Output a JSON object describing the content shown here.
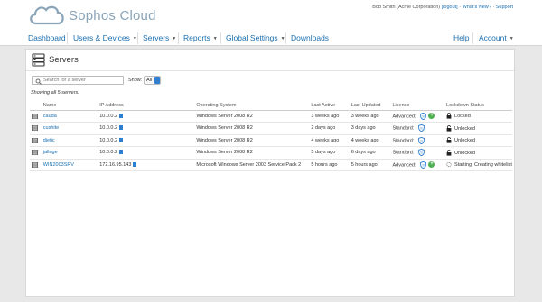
{
  "app": {
    "logo_text": "Sophos Cloud"
  },
  "userbar": {
    "user": "Bob Smith (Acme Corporation)",
    "logout": "[logout]",
    "whats_new": "What's New?",
    "support": "Support",
    "sep": "·"
  },
  "nav": {
    "dashboard": "Dashboard",
    "users_devices": "Users & Devices",
    "servers": "Servers",
    "reports": "Reports",
    "global_settings": "Global Settings",
    "downloads": "Downloads",
    "help": "Help",
    "account": "Account",
    "caret": "▼"
  },
  "page": {
    "title": "Servers",
    "search_placeholder": "Search for a server",
    "show_label": "Show:",
    "show_value": "All",
    "showing_text": "Showing all 5 servers."
  },
  "table": {
    "headers": [
      "Name",
      "IP Address",
      "Operating System",
      "Last Active",
      "Last Updated",
      "License",
      "Lockdown Status"
    ],
    "rows": [
      {
        "name": "cauda",
        "ip": "10.0.0.2",
        "os": "Windows Server 2008 R2",
        "last_active": "3 weeks ago",
        "last_updated": "3 weeks ago",
        "license": "Advanced:",
        "status": "Locked"
      },
      {
        "name": "cushite",
        "ip": "10.0.0.2",
        "os": "Windows Server 2008 R2",
        "last_active": "2 days ago",
        "last_updated": "3 days ago",
        "license": "Standard:",
        "status": "Unlocked"
      },
      {
        "name": "dietic",
        "ip": "10.0.0.2",
        "os": "Windows Server 2008 R2",
        "last_active": "4 weeks ago",
        "last_updated": "4 weeks ago",
        "license": "Standard:",
        "status": "Unlocked"
      },
      {
        "name": "jallage",
        "ip": "10.0.0.2",
        "os": "Windows Server 2008 R2",
        "last_active": "5 days ago",
        "last_updated": "6 days ago",
        "license": "Standard:",
        "status": "Unlocked"
      },
      {
        "name": "WIN2003SRV",
        "ip": "172.16.95.143",
        "os": "Microsoft Windows Server 2003 Service Pack 2",
        "last_active": "5 hours ago",
        "last_updated": "5 hours ago",
        "license": "Advanced:",
        "status": "Starting, Creating whitelist"
      }
    ]
  },
  "colors": {
    "link": "#1a6fb0",
    "logo": "#8aa4b8",
    "accent": "#2f7fd0",
    "plus": "#4caf50"
  }
}
